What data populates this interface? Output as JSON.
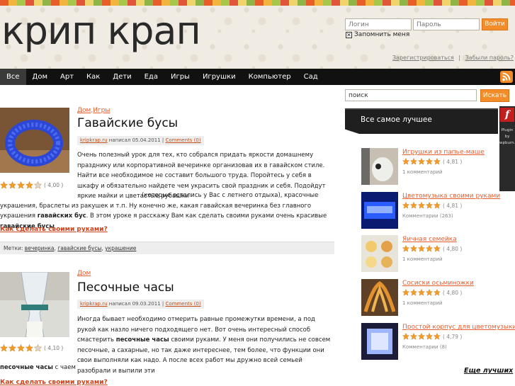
{
  "header": {
    "logo": "крип крап",
    "login_placeholder": "Логин",
    "password_placeholder": "Пароль",
    "login_button": "Войти",
    "remember_label": "Запомнить меня",
    "register_link": "Зарегистрироваться",
    "separator": "|",
    "forgot_link": "Забыли пароль?"
  },
  "nav": {
    "items": [
      "Все",
      "Дом",
      "Арт",
      "Как",
      "Дети",
      "Еда",
      "Игры",
      "Игрушки",
      "Компьютер",
      "Сад"
    ],
    "active": "Все",
    "rss_icon": "rss-icon"
  },
  "search": {
    "value": "поиск",
    "button": "Искать"
  },
  "posts": [
    {
      "cat1": "Дом",
      "cat_sep": ",",
      "cat2": "Игры",
      "title": "Гавайские бусы",
      "author": "kripkrap.ru",
      "wrote": " написал 05.04.2011 | ",
      "comments": "Comments (0)",
      "rating": 4.0,
      "rating_text": "( 4,00 )",
      "body1": "Очень полезный урок для тех, кто собрался придать яркости домашнему празднику или корпоративной вечеринке организовав их в гавайском стиле. Найти все необходимое не составит большого труда. Поройтесь у себя в шкафу и обязательно найдете чем украсить свой праздник и себя. Подойдут яркие майки и цветастые рубашки",
      "body2": "(которые остались у Вас с летнего отдыха), красочные украшения, браслеты из ракушек и т.п. Ну конечно же, какая гавайская вечеринка без главного украшения ",
      "body2_bold": "гавайских бус",
      "body3": ". В этом уроке я расскажу Вам как сделать своими руками очень красивые ",
      "body3_bold": "гавайские бусы",
      "readmore": "Как сделать своими руками?",
      "tags_label": "Метки: ",
      "tag1": "вечеринка",
      "tag2": "гавайские бусы",
      "tag3": "украшение",
      "tag_sep": ", "
    },
    {
      "cat1": "Дом",
      "title": "Песочные часы",
      "author": "kripkrap.ru",
      "wrote": " написал 09.03.2011 | ",
      "comments": "Comments (0)",
      "rating": 4.1,
      "rating_text": "( 4,10 )",
      "body1": "Иногда бывает необходимо отмерить равные промежутки времени, а под рукой как назло ничего подходящего нет. Вот очень интересный способ смастерить ",
      "body1_bold": "песочные часы",
      "body2": " своими руками. У меня они получились не совсем песочные, а сахарные, но так даже интереснее, тем более, что функции они свои выполняли как надо. А после всех работ мы дружно всей семьей разобрали и выпили эти",
      "body3_bold": "песочные часы",
      "body3": " с чаем",
      "readmore": "Как сделать своими руками?"
    }
  ],
  "sidebar": {
    "best_title": "Все самое лучшее",
    "flash_letter": "f",
    "flash_text": "Plugin by wpburn.com",
    "items": [
      {
        "title": "Игрушки из папье-маше",
        "rating": 4.81,
        "rating_text": "( 4,81 )",
        "comments": "1 комментарий"
      },
      {
        "title": "Цветомузыка своими руками",
        "rating": 4.81,
        "rating_text": "( 4,81 )",
        "comments": "Комментарии (263)"
      },
      {
        "title": "Яичная семейка",
        "rating": 4.8,
        "rating_text": "( 4,80 )",
        "comments": "1 комментарий"
      },
      {
        "title": "Сосиски осьминожки",
        "rating": 4.8,
        "rating_text": "( 4,80 )",
        "comments": "1 комментарий"
      },
      {
        "title": "Простой корпус для цветомузыки",
        "rating": 4.79,
        "rating_text": "( 4,79 )",
        "comments": "Комментарии (8)"
      }
    ],
    "more": "Еще лучших"
  }
}
